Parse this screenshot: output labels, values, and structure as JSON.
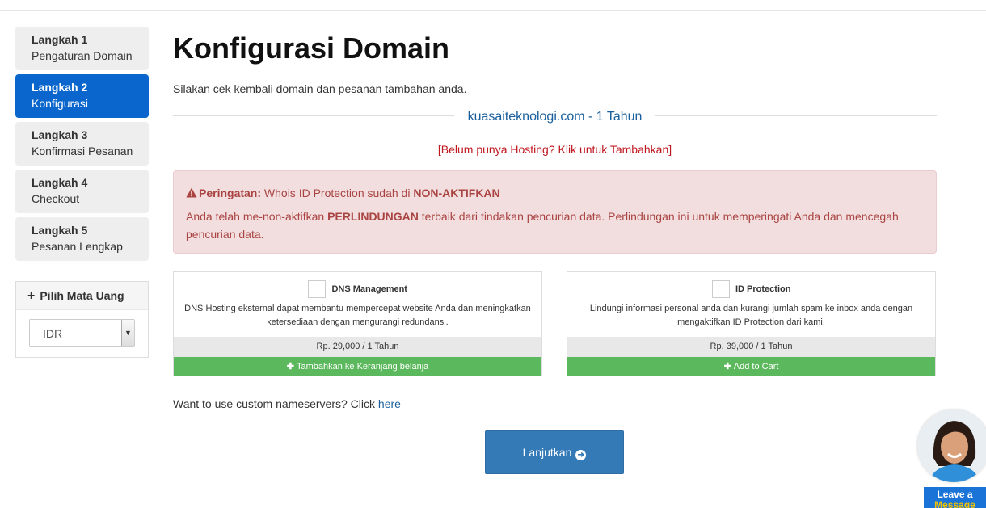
{
  "steps": [
    {
      "title": "Langkah 1",
      "subtitle": "Pengaturan Domain",
      "active": false
    },
    {
      "title": "Langkah 2",
      "subtitle": "Konfigurasi",
      "active": true
    },
    {
      "title": "Langkah 3",
      "subtitle": "Konfirmasi Pesanan",
      "active": false
    },
    {
      "title": "Langkah 4",
      "subtitle": "Checkout",
      "active": false
    },
    {
      "title": "Langkah 5",
      "subtitle": "Pesanan Lengkap",
      "active": false
    }
  ],
  "currency": {
    "header": "Pilih Mata Uang",
    "selected": "IDR"
  },
  "page": {
    "title": "Konfigurasi Domain",
    "intro": "Silakan cek kembali domain dan pesanan tambahan anda.",
    "domain_label": "kuasaiteknologi.com - 1 Tahun",
    "hosting_link": "[Belum punya Hosting? Klik untuk Tambahkan]"
  },
  "alert": {
    "label": "Peringatan:",
    "text_before": "Whois ID Protection sudah di",
    "status": "NON-AKTIFKAN",
    "body_before": "Anda telah me-non-aktifkan",
    "body_strong": "PERLINDUNGAN",
    "body_after": "terbaik dari tindakan pencurian data. Perlindungan ini untuk memperingati Anda dan mencegah pencurian data."
  },
  "addons": [
    {
      "name": "DNS Management",
      "description": "DNS Hosting eksternal dapat membantu mempercepat website Anda dan meningkatkan ketersediaan dengan mengurangi redundansi.",
      "price": "Rp. 29,000 / 1 Tahun",
      "button": "Tambahkan ke Keranjang belanja",
      "checked": false
    },
    {
      "name": "ID Protection",
      "description": "Lindungi informasi personal anda dan kurangi jumlah spam ke inbox anda dengan mengaktifkan ID Protection dari kami.",
      "price": "Rp. 39,000 / 1 Tahun",
      "button": "Add to Cart",
      "checked": false
    }
  ],
  "nameservers": {
    "text": "Want to use custom nameservers? Click",
    "link": "here"
  },
  "continue_button": "Lanjutkan",
  "chat": {
    "line1": "Leave a",
    "line2": "Message"
  },
  "colors": {
    "active_step": "#0a66cc",
    "alert_bg": "#f2dede",
    "alert_text": "#a94442",
    "addon_button": "#5cb85c",
    "primary_button": "#337ab7",
    "link": "#1a5f9c",
    "hosting_link": "#c0171f"
  }
}
